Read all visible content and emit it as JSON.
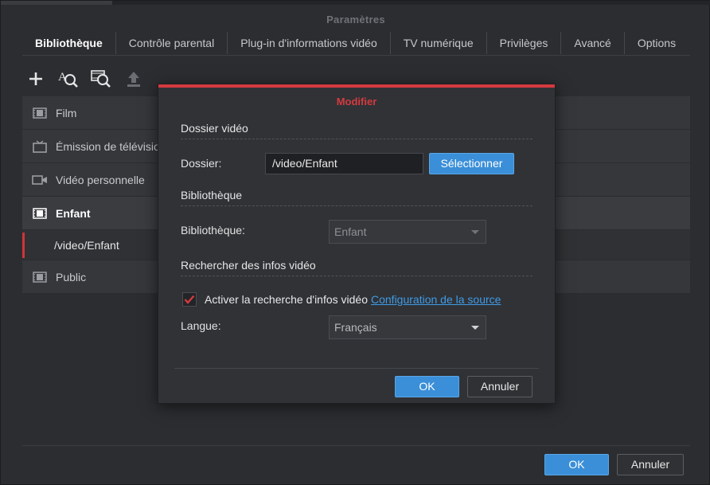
{
  "window": {
    "title": "Paramètres"
  },
  "tabs": [
    {
      "label": "Bibliothèque",
      "active": true
    },
    {
      "label": "Contrôle parental"
    },
    {
      "label": "Plug-in d'informations vidéo"
    },
    {
      "label": "TV numérique"
    },
    {
      "label": "Privilèges"
    },
    {
      "label": "Avancé"
    },
    {
      "label": "Options"
    }
  ],
  "toolbar": {
    "icons": [
      "add-icon",
      "search-info-icon",
      "scan-icon",
      "upload-icon"
    ]
  },
  "libraries": [
    {
      "label": "Film",
      "icon": "film-icon"
    },
    {
      "label": "Émission de télévision",
      "icon": "tv-icon"
    },
    {
      "label": "Vidéo personnelle",
      "icon": "camera-icon"
    },
    {
      "label": "Enfant",
      "icon": "film-icon",
      "selected": true
    },
    {
      "label": "/video/Enfant",
      "sub": true
    },
    {
      "label": "Public",
      "icon": "film-icon"
    }
  ],
  "footer": {
    "ok_label": "OK",
    "cancel_label": "Annuler"
  },
  "dialog": {
    "title": "Modifier",
    "folder_section": "Dossier vidéo",
    "folder_label": "Dossier:",
    "folder_value": "/video/Enfant",
    "select_button": "Sélectionner",
    "library_section": "Bibliothèque",
    "library_label": "Bibliothèque:",
    "library_value": "Enfant",
    "search_section": "Rechercher des infos vidéo",
    "search_checkbox_label": "Activer la recherche d'infos vidéo",
    "search_checked": true,
    "source_link": "Configuration de la source",
    "language_label": "Langue:",
    "language_value": "Français",
    "ok_label": "OK",
    "cancel_label": "Annuler"
  },
  "colors": {
    "accent": "#3a8fd8",
    "alert": "#d43a3f",
    "link": "#3f9be6"
  }
}
